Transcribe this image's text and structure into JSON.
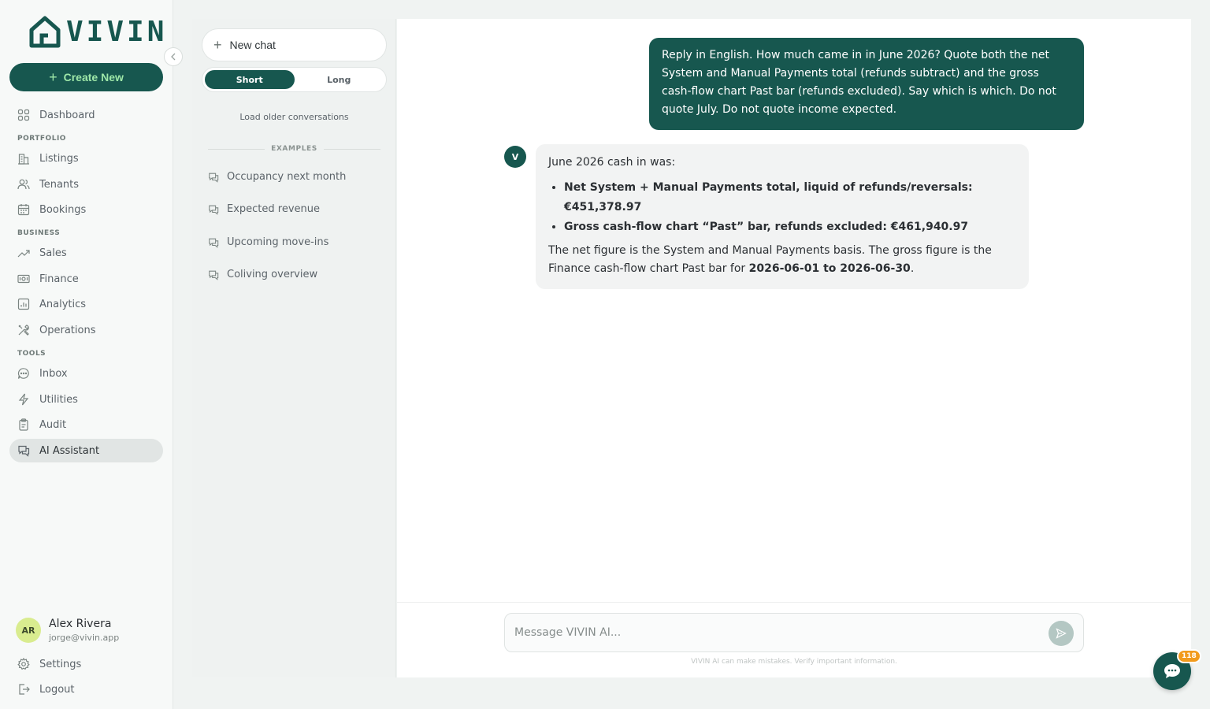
{
  "brand": {
    "name": "VIVIN",
    "color": "#17574f"
  },
  "nav": {
    "create_label": "Create New",
    "items": [
      {
        "label": "Dashboard",
        "icon": "grid-icon"
      },
      {
        "label": "Listings",
        "icon": "building-icon"
      },
      {
        "label": "Tenants",
        "icon": "users-icon"
      },
      {
        "label": "Bookings",
        "icon": "calendar-icon"
      },
      {
        "label": "Sales",
        "icon": "trending-up-icon"
      },
      {
        "label": "Finance",
        "icon": "banknote-icon"
      },
      {
        "label": "Analytics",
        "icon": "bar-chart-icon"
      },
      {
        "label": "Operations",
        "icon": "tools-icon"
      },
      {
        "label": "Inbox",
        "icon": "message-icon"
      },
      {
        "label": "Utilities",
        "icon": "bolt-icon"
      },
      {
        "label": "Audit",
        "icon": "clipboard-icon"
      },
      {
        "label": "AI Assistant",
        "icon": "chat-bubbles-icon",
        "active": true
      }
    ],
    "sections": {
      "portfolio": "PORTFOLIO",
      "business": "BUSINESS",
      "tools": "TOOLS"
    },
    "settings_label": "Settings",
    "logout_label": "Logout"
  },
  "user": {
    "initials": "AR",
    "name": "Alex Rivera",
    "email": "jorge@vivin.app"
  },
  "conversations": {
    "new_chat_label": "New chat",
    "toggle": {
      "short": "Short",
      "long": "Long",
      "selected": "Short"
    },
    "load_older": "Load older conversations",
    "examples_heading": "EXAMPLES",
    "examples": [
      "Occupancy next month",
      "Expected revenue",
      "Upcoming move-ins",
      "Coliving overview"
    ]
  },
  "chat": {
    "user_message": "Reply in English. How much came in in June 2026? Quote both the net System and Manual Payments total (refunds subtract) and the gross cash-flow chart Past bar (refunds excluded). Say which is which. Do not quote July. Do not quote income expected.",
    "bot_initial": "V",
    "bot_intro": "June 2026 cash in was:",
    "bot_bullets": [
      "Net System + Manual Payments total, liquid of refunds/reversals: €451,378.97",
      "Gross cash-flow chart “Past” bar, refunds excluded: €461,940.97"
    ],
    "bot_outro_prefix": "The net figure is the System and Manual Payments basis. The gross figure is the Finance cash-flow chart Past bar for ",
    "bot_outro_range": "2026-06-01 to 2026-06-30",
    "bot_outro_suffix": ".",
    "input_placeholder": "Message VIVIN AI...",
    "disclaimer": "VIVIN AI can make mistakes. Verify important information."
  },
  "widget": {
    "badge": "118"
  }
}
